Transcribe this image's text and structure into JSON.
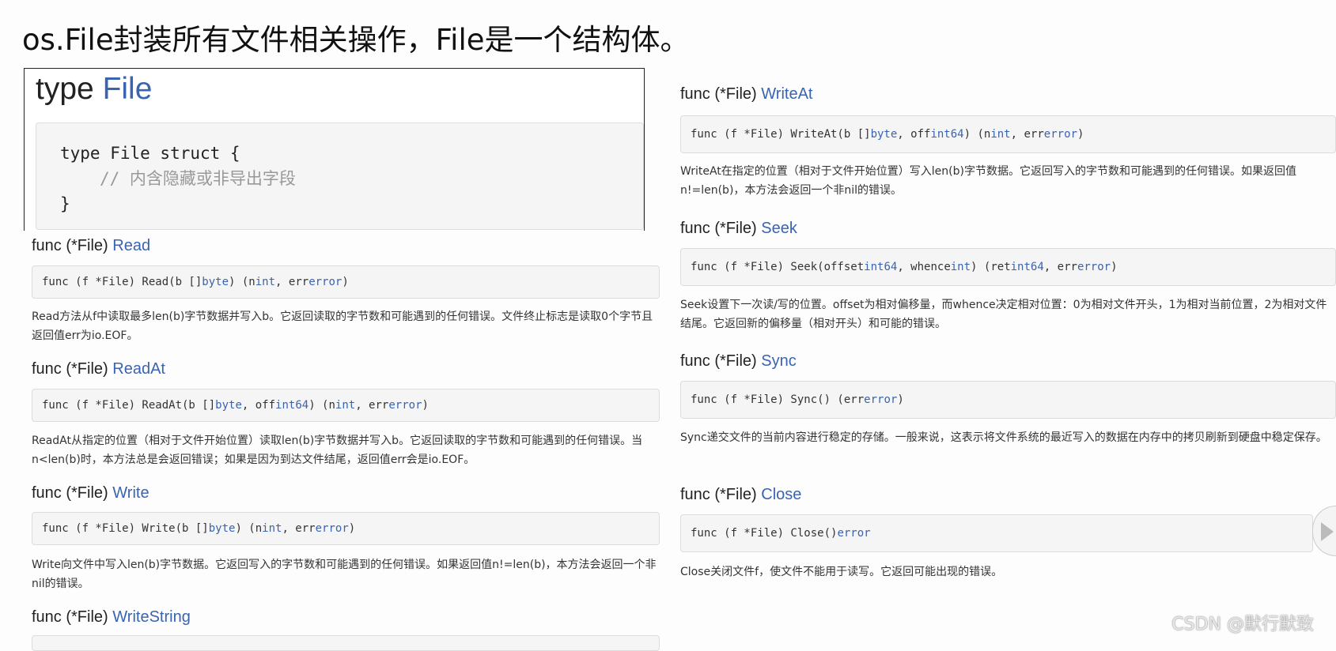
{
  "title": "os.File封装所有文件相关操作，File是一个结构体。",
  "type_block": {
    "keyword": "type",
    "name": "File",
    "code_line1": "type File struct {",
    "code_comment": "// 内含隐藏或非导出字段",
    "code_line3": "}"
  },
  "left": {
    "read": {
      "prefix": "func (*File)",
      "name": "Read",
      "sig_pre": "func (f *File) Read(b []",
      "sig_kw1": "byte",
      "sig_mid": ") (n ",
      "sig_kw2": "int",
      "sig_mid2": ", err ",
      "sig_kw3": "error",
      "sig_end": ")",
      "desc": "Read方法从f中读取最多len(b)字节数据并写入b。它返回读取的字节数和可能遇到的任何错误。文件终止标志是读取0个字节且返回值err为io.EOF。"
    },
    "readat": {
      "prefix": "func (*File)",
      "name": "ReadAt",
      "sig_pre": "func (f *File) ReadAt(b []",
      "sig_kw1": "byte",
      "sig_mid": ", off ",
      "sig_kw2": "int64",
      "sig_mid2": ") (n ",
      "sig_kw3": "int",
      "sig_mid3": ", err ",
      "sig_kw4": "error",
      "sig_end": ")",
      "desc": "ReadAt从指定的位置（相对于文件开始位置）读取len(b)字节数据并写入b。它返回读取的字节数和可能遇到的任何错误。当n<len(b)时，本方法总是会返回错误；如果是因为到达文件结尾，返回值err会是io.EOF。"
    },
    "write": {
      "prefix": "func (*File)",
      "name": "Write",
      "sig_pre": "func (f *File) Write(b []",
      "sig_kw1": "byte",
      "sig_mid": ") (n ",
      "sig_kw2": "int",
      "sig_mid2": ", err ",
      "sig_kw3": "error",
      "sig_end": ")",
      "desc": "Write向文件中写入len(b)字节数据。它返回写入的字节数和可能遇到的任何错误。如果返回值n!=len(b)，本方法会返回一个非nil的错误。"
    },
    "writestring": {
      "prefix": "func (*File)",
      "name": "WriteString"
    }
  },
  "right": {
    "writeat": {
      "prefix": "func (*File)",
      "name": "WriteAt",
      "sig_pre": "func (f *File) WriteAt(b []",
      "sig_kw1": "byte",
      "sig_mid": ", off ",
      "sig_kw2": "int64",
      "sig_mid2": ") (n ",
      "sig_kw3": "int",
      "sig_mid3": ", err ",
      "sig_kw4": "error",
      "sig_end": ")",
      "desc": "WriteAt在指定的位置（相对于文件开始位置）写入len(b)字节数据。它返回写入的字节数和可能遇到的任何错误。如果返回值n!=len(b)，本方法会返回一个非nil的错误。"
    },
    "seek": {
      "prefix": "func (*File)",
      "name": "Seek",
      "sig_pre": "func (f *File) Seek(offset ",
      "sig_kw1": "int64",
      "sig_mid": ", whence ",
      "sig_kw2": "int",
      "sig_mid2": ") (ret ",
      "sig_kw3": "int64",
      "sig_mid3": ", err ",
      "sig_kw4": "error",
      "sig_end": ")",
      "desc": "Seek设置下一次读/写的位置。offset为相对偏移量，而whence决定相对位置：0为相对文件开头，1为相对当前位置，2为相对文件结尾。它返回新的偏移量（相对开头）和可能的错误。"
    },
    "sync": {
      "prefix": "func (*File)",
      "name": "Sync",
      "sig_pre": "func (f *File) Sync() (err ",
      "sig_kw1": "error",
      "sig_end": ")",
      "desc": "Sync递交文件的当前内容进行稳定的存储。一般来说，这表示将文件系统的最近写入的数据在内存中的拷贝刷新到硬盘中稳定保存。"
    },
    "close": {
      "prefix": "func (*File)",
      "name": "Close",
      "sig_pre": "func (f *File) Close() ",
      "sig_kw1": "error",
      "desc": "Close关闭文件f，使文件不能用于读写。它返回可能出现的错误。"
    }
  },
  "watermark": "CSDN @默行默致"
}
